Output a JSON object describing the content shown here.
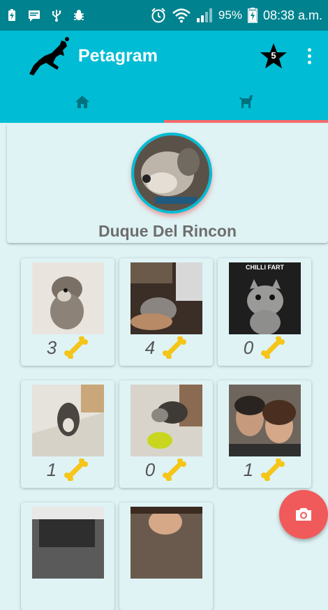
{
  "status_bar": {
    "battery_percent": "95%",
    "time": "08:38 a.m.",
    "icons": [
      "battery-charging-icon",
      "message-icon",
      "usb-icon",
      "bug-icon",
      "alarm-icon",
      "wifi-icon",
      "signal-icon",
      "battery-icon"
    ]
  },
  "app_bar": {
    "title": "Petagram",
    "star_badge": "5",
    "icons": [
      "dog-logo-icon",
      "star-icon",
      "more-vert-icon"
    ]
  },
  "tabs": [
    {
      "icon": "home-icon",
      "selected": false
    },
    {
      "icon": "dog-icon",
      "selected": true
    }
  ],
  "profile": {
    "name": "Duque Del Rincon"
  },
  "posts": [
    {
      "likes": "3"
    },
    {
      "likes": "4"
    },
    {
      "likes": "0",
      "caption": "CHILLI FART"
    },
    {
      "likes": "1"
    },
    {
      "likes": "0"
    },
    {
      "likes": "1"
    },
    {},
    {}
  ],
  "fab": {
    "icon": "camera-icon"
  },
  "colors": {
    "status_bar": "#00838f",
    "primary": "#00bcd4",
    "background": "#dff3f5",
    "accent": "#f05a5a",
    "bone": "#f5c518"
  }
}
